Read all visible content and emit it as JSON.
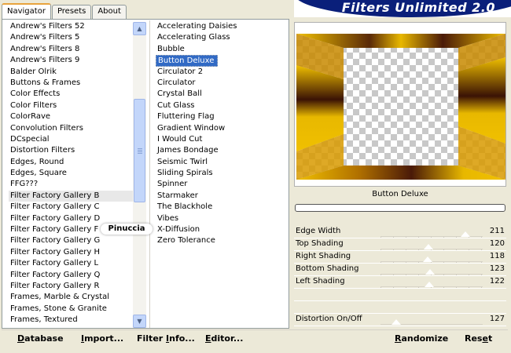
{
  "tabs": [
    {
      "label": "Navigator",
      "active": true
    },
    {
      "label": "Presets",
      "active": false
    },
    {
      "label": "About",
      "active": false
    }
  ],
  "brand_title": "Filters Unlimited 2.0",
  "categories": [
    "Andrew's Filters 52",
    "Andrew's Filters 5",
    "Andrew's Filters 8",
    "Andrew's Filters 9",
    "Balder Olrik",
    "Buttons & Frames",
    "Color Effects",
    "Color Filters",
    "ColorRave",
    "Convolution Filters",
    "DCspecial",
    "Distortion Filters",
    "Edges, Round",
    "Edges, Square",
    "FFG???",
    "Filter Factory Gallery B",
    "Filter Factory Gallery C",
    "Filter Factory Gallery D",
    "Filter Factory Gallery F",
    "Filter Factory Gallery G",
    "Filter Factory Gallery H",
    "Filter Factory Gallery L",
    "Filter Factory Gallery Q",
    "Filter Factory Gallery R",
    "Frames, Marble & Crystal",
    "Frames, Stone & Granite",
    "Frames, Textured"
  ],
  "selected_category": "Filter Factory Gallery B",
  "filters": [
    "Accelerating Daisies",
    "Accelerating Glass",
    "Bubble",
    "Button Deluxe",
    "Circulator 2",
    "Circulator",
    "Crystal Ball",
    "Cut Glass",
    "Fluttering Flag",
    "Gradient Window",
    "I Would Cut",
    "James Bondage",
    "Seismic Twirl",
    "Sliding Spirals",
    "Spinner",
    "Starmaker",
    "The Blackhole",
    "Vibes",
    "X-Diffusion",
    "Zero Tolerance"
  ],
  "selected_filter": "Button Deluxe",
  "watermark_text": "Pinuccia",
  "preview_filter_name": "Button Deluxe",
  "parameters": [
    {
      "label": "Edge Width",
      "value": "211"
    },
    {
      "label": "Top Shading",
      "value": "120"
    },
    {
      "label": "Right Shading",
      "value": "118"
    },
    {
      "label": "Bottom Shading",
      "value": "123"
    },
    {
      "label": "Left Shading",
      "value": "122"
    }
  ],
  "parameter_extra": {
    "label": "Distortion On/Off",
    "value": "127"
  },
  "buttons": {
    "database": {
      "pre": "",
      "u": "D",
      "post": "atabase"
    },
    "import": {
      "pre": "",
      "u": "I",
      "post": "mport..."
    },
    "filter_info": {
      "pre": "Filter ",
      "u": "I",
      "post": "nfo..."
    },
    "editor": {
      "pre": "",
      "u": "E",
      "post": "ditor..."
    },
    "randomize": {
      "pre": "",
      "u": "R",
      "post": "andomize"
    },
    "reset": {
      "pre": "Res",
      "u": "e",
      "post": "t"
    }
  },
  "colors": {
    "selection": "#316ac5",
    "brand_blue": "#0a1f7a",
    "frame_gold": "#e8b800",
    "frame_dark": "#4a1a08",
    "background": "#ece9d8"
  }
}
